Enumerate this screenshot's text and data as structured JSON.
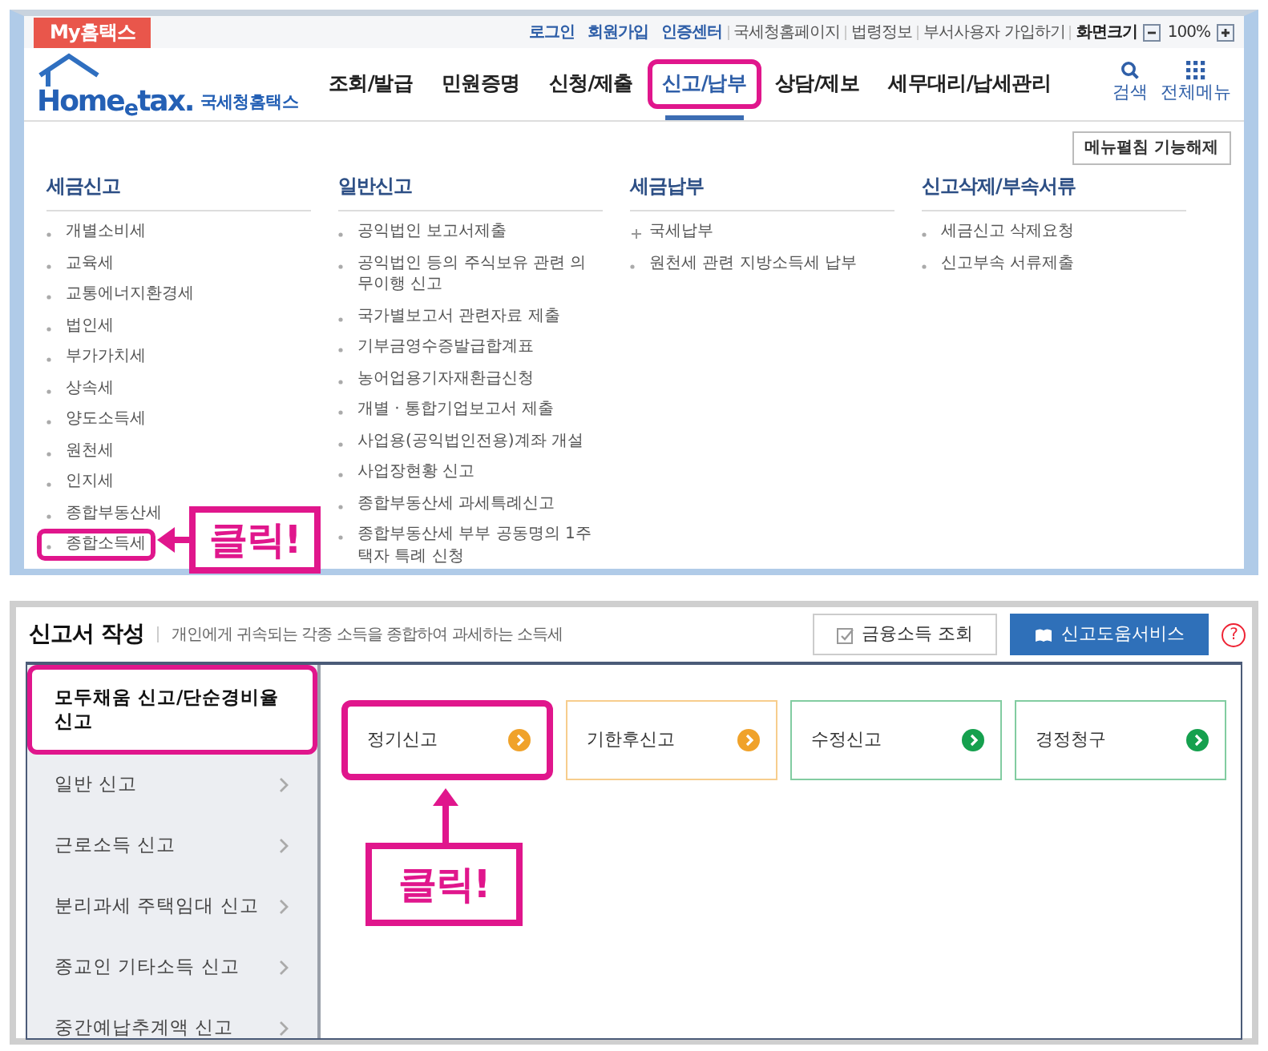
{
  "top_panel": {
    "brand_tab": "My홈택스",
    "util_links": [
      {
        "label": "로그인",
        "kind": "primary"
      },
      {
        "label": "회원가입",
        "kind": "primary"
      },
      {
        "label": "인증센터",
        "kind": "primary"
      },
      {
        "label": "국세청홈페이지",
        "kind": "plain"
      },
      {
        "label": "법령정보",
        "kind": "plain"
      },
      {
        "label": "부서사용자 가입하기",
        "kind": "plain"
      },
      {
        "label": "화면크기",
        "kind": "label"
      }
    ],
    "zoom_value": "100%",
    "logo": {
      "name": "Home$_{e}$tax.",
      "subtitle": "국세청홈택스"
    },
    "nav": [
      {
        "label": "조회/발급",
        "selected": false,
        "highlighted": false
      },
      {
        "label": "민원증명",
        "selected": false,
        "highlighted": false
      },
      {
        "label": "신청/제출",
        "selected": false,
        "highlighted": false
      },
      {
        "label": "신고/납부",
        "selected": true,
        "highlighted": true
      },
      {
        "label": "상담/제보",
        "selected": false,
        "highlighted": false
      },
      {
        "label": "세무대리/납세관리",
        "selected": false,
        "highlighted": false
      }
    ],
    "nav_tools": [
      {
        "label": "검색",
        "kind": "search"
      },
      {
        "label": "전체메뉴",
        "kind": "grid"
      }
    ],
    "menu_toggle_button": "메뉴펼침 기능해제",
    "menu_columns": [
      {
        "title": "세금신고",
        "items": [
          {
            "label": "개별소비세",
            "kind": "bullet",
            "highlighted": false
          },
          {
            "label": "교육세",
            "kind": "bullet",
            "highlighted": false
          },
          {
            "label": "교통에너지환경세",
            "kind": "bullet",
            "highlighted": false
          },
          {
            "label": "법인세",
            "kind": "bullet",
            "highlighted": false
          },
          {
            "label": "부가가치세",
            "kind": "bullet",
            "highlighted": false
          },
          {
            "label": "상속세",
            "kind": "bullet",
            "highlighted": false
          },
          {
            "label": "양도소득세",
            "kind": "bullet",
            "highlighted": false
          },
          {
            "label": "원천세",
            "kind": "bullet",
            "highlighted": false
          },
          {
            "label": "인지세",
            "kind": "bullet",
            "highlighted": false
          },
          {
            "label": "종합부동산세",
            "kind": "bullet",
            "highlighted": false
          },
          {
            "label": "종합소득세",
            "kind": "bullet",
            "highlighted": true
          }
        ]
      },
      {
        "title": "일반신고",
        "items": [
          {
            "label": "공익법인 보고서제출",
            "kind": "bullet",
            "highlighted": false
          },
          {
            "label": "공익법인 등의 주식보유 관련 의무이행 신고",
            "kind": "bullet",
            "highlighted": false
          },
          {
            "label": "국가별보고서 관련자료 제출",
            "kind": "bullet",
            "highlighted": false
          },
          {
            "label": "기부금영수증발급합계표",
            "kind": "bullet",
            "highlighted": false
          },
          {
            "label": "농어업용기자재환급신청",
            "kind": "bullet",
            "highlighted": false
          },
          {
            "label": "개별 · 통합기업보고서 제출",
            "kind": "bullet",
            "highlighted": false
          },
          {
            "label": "사업용(공익법인전용)계좌 개설",
            "kind": "bullet",
            "highlighted": false
          },
          {
            "label": "사업장현황 신고",
            "kind": "bullet",
            "highlighted": false
          },
          {
            "label": "종합부동산세 과세특례신고",
            "kind": "bullet",
            "highlighted": false
          },
          {
            "label": "종합부동산세 부부 공동명의 1주택자 특례 신청",
            "kind": "bullet",
            "highlighted": false
          }
        ]
      },
      {
        "title": "세금납부",
        "items": [
          {
            "label": "국세납부",
            "kind": "plus",
            "highlighted": false
          },
          {
            "label": "원천세 관련 지방소득세 납부",
            "kind": "bullet",
            "highlighted": false
          }
        ]
      },
      {
        "title": "신고삭제/부속서류",
        "items": [
          {
            "label": "세금신고 삭제요청",
            "kind": "bullet",
            "highlighted": false
          },
          {
            "label": "신고부속 서류제출",
            "kind": "bullet",
            "highlighted": false
          }
        ]
      }
    ]
  },
  "bottom_panel": {
    "title": "신고서 작성",
    "description": "개인에게 귀속되는 각종 소득을 종합하여 과세하는 소득세",
    "buttons": [
      {
        "label": "금융소득 조회",
        "kind": "outline"
      },
      {
        "label": "신고도움서비스",
        "kind": "primary"
      }
    ],
    "help": "?",
    "sidebar": [
      {
        "label": "모두채움 신고/단순경비율 신고",
        "selected": true,
        "highlighted": true
      },
      {
        "label": "일반 신고",
        "selected": false,
        "highlighted": false
      },
      {
        "label": "근로소득 신고",
        "selected": false,
        "highlighted": false
      },
      {
        "label": "분리과세 주택임대 신고",
        "selected": false,
        "highlighted": false
      },
      {
        "label": "종교인 기타소득 신고",
        "selected": false,
        "highlighted": false
      },
      {
        "label": "중간예납추계액 신고",
        "selected": false,
        "highlighted": false
      }
    ],
    "cards": [
      {
        "label": "정기신고",
        "color": "#f0a22a",
        "highlighted": true
      },
      {
        "label": "기한후신고",
        "color": "#f0a22a",
        "highlighted": false
      },
      {
        "label": "수정신고",
        "color": "#15a04e",
        "highlighted": false
      },
      {
        "label": "경정청구",
        "color": "#15a04e",
        "highlighted": false
      }
    ]
  },
  "annotations": [
    {
      "label": "클릭!"
    },
    {
      "label": "클릭!"
    }
  ]
}
